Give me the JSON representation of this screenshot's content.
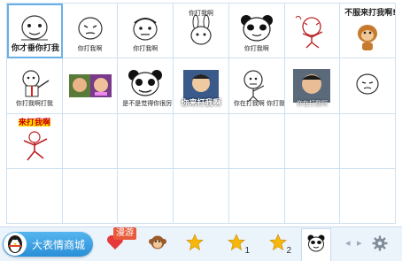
{
  "stickers": {
    "s1": "你才垂你打我",
    "s2": "你打我啊",
    "s3": "你打我啊",
    "s4": "你打我啊",
    "s5": "你打我啊",
    "s6": "",
    "s7": "不服来打我啊!",
    "s8": "你打我啊打我",
    "s9": "",
    "s10": "是不是觉得你很厉害 打我",
    "s11": "你来打我啊",
    "s12": "你在打我啊 你打我啊",
    "s13": "你在打我啊",
    "s14": "",
    "s15": "来打我啊"
  },
  "toolbar": {
    "mall_label": "大表情商城",
    "badge": "漫游",
    "tab_star1_sub": "1",
    "tab_star2_sub": "2",
    "prev": "◂",
    "next": "▸"
  },
  "colors": {
    "accent": "#2a8fd8",
    "grid": "#cfe0ef",
    "toolbar_bg": "#ebf3fb",
    "badge": "#e85a3a",
    "star": "#f5b70a",
    "heart": "#e63a3a"
  },
  "icons": [
    "penguin-icon",
    "heart-icon",
    "monkey-icon",
    "star-icon",
    "star-1-icon",
    "star-2-icon",
    "panda-tab-icon",
    "gear-icon"
  ]
}
